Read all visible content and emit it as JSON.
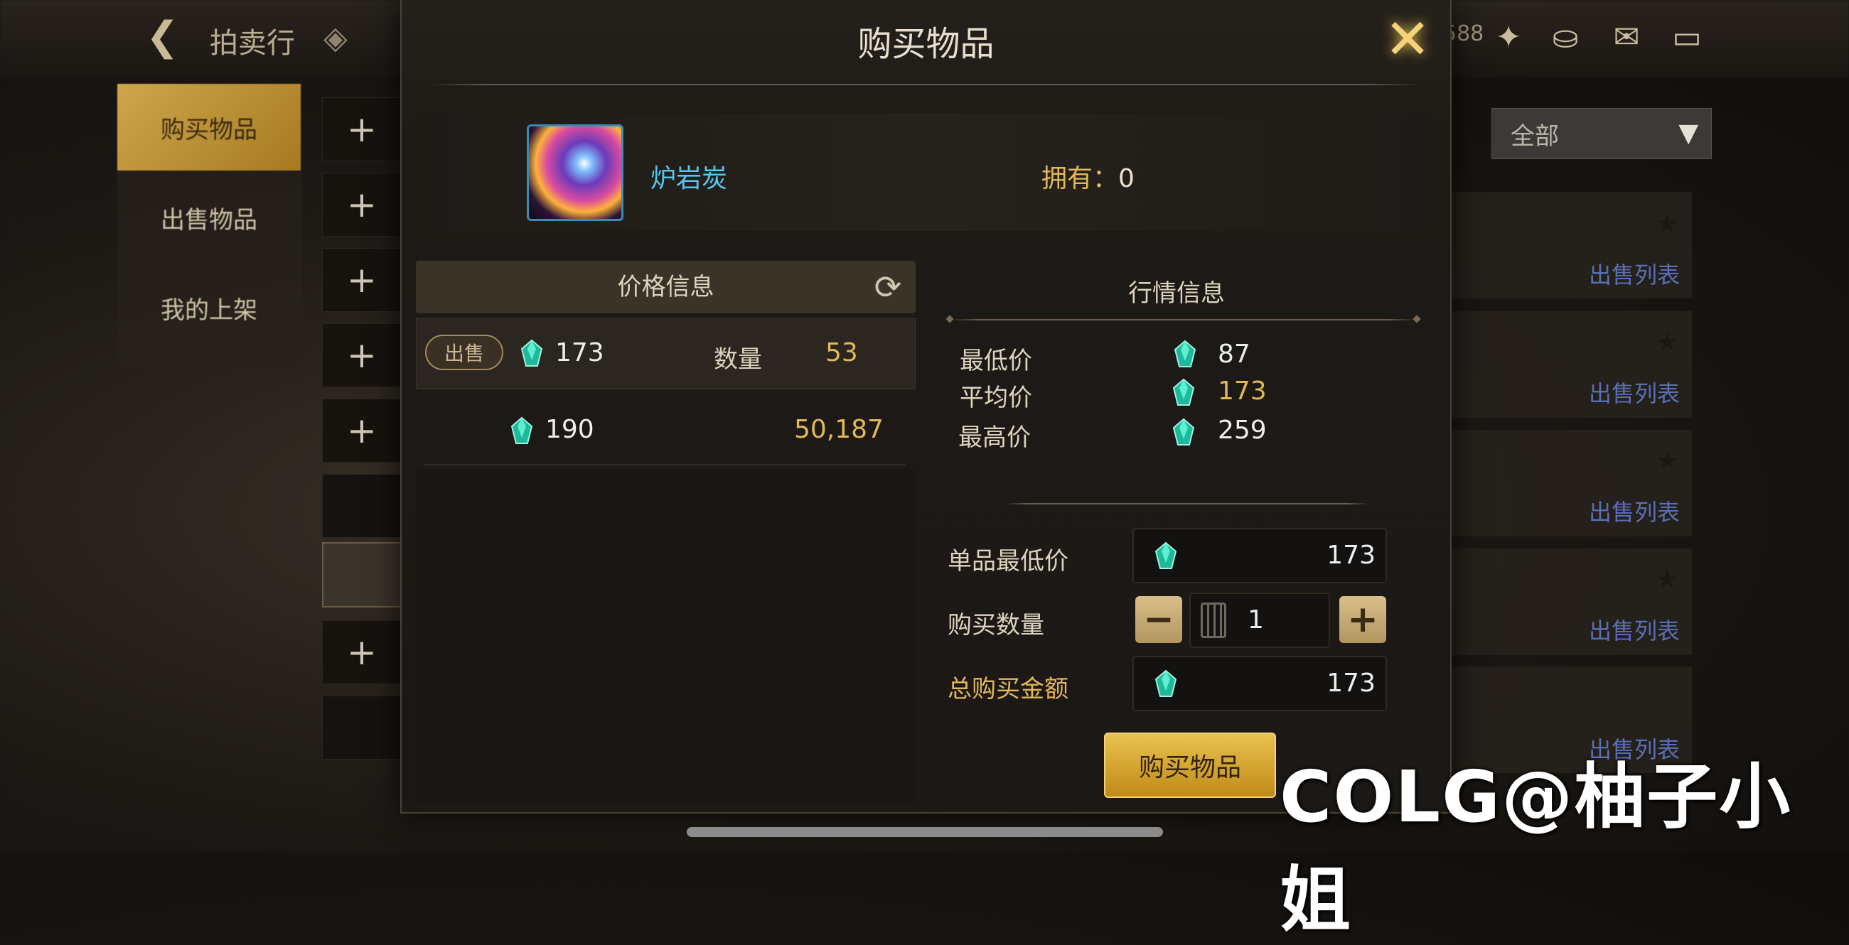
{
  "background": {
    "title": "拍卖行",
    "tabs": [
      "购买物品",
      "出售物品",
      "我的上架"
    ],
    "plus_symbol": "+",
    "filter_value": "全部",
    "currency_fragment": "588",
    "row_links": [
      "出售列表",
      "出售列表",
      "出售列表",
      "出售列表",
      "出售列表"
    ]
  },
  "dialog": {
    "title": "购买物品",
    "item": {
      "name": "炉岩炭",
      "owned_label": "拥有：",
      "owned_value": "0"
    },
    "price_panel": {
      "header": "价格信息",
      "rows": [
        {
          "badge": "出售",
          "price": "173",
          "qty_label": "数量",
          "qty": "53"
        },
        {
          "badge": "",
          "price": "190",
          "qty_label": "",
          "qty": "50,187"
        }
      ]
    },
    "market": {
      "title": "行情信息",
      "lowest_label": "最低价",
      "lowest_value": "87",
      "average_label": "平均价",
      "average_value": "173",
      "highest_label": "最高价",
      "highest_value": "259"
    },
    "form": {
      "unit_lowest_label": "单品最低价",
      "unit_lowest_value": "173",
      "quantity_label": "购买数量",
      "quantity_value": "1",
      "minus": "−",
      "plus": "+",
      "total_label": "总购买金额",
      "total_value": "173"
    },
    "buy_button": "购买物品",
    "close_symbol": "✕"
  },
  "watermark": "COLG@柚子小姐",
  "colors": {
    "accent_gold": "#e3b75a",
    "item_name_blue": "#55c6f0",
    "gem_teal": "#2fd6b4"
  },
  "icons": {
    "currency": "gem-icon",
    "refresh": "refresh-icon",
    "close": "close-icon",
    "calculator": "calculator-icon"
  }
}
